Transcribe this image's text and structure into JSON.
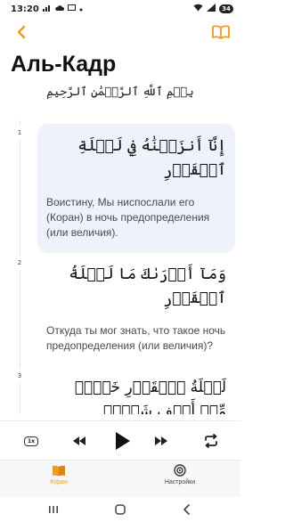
{
  "status": {
    "time": "13:20",
    "battery": "34"
  },
  "page": {
    "title": "Аль-Кадр",
    "basmala": "بِسۡمِ ٱللَّهِ ٱلرَّحۡمَٰنِ ٱلرَّحِيمِ"
  },
  "verses": [
    {
      "number": "1",
      "arabic": "إِنَّآ أَنزَلۡنَٰهُ فِي لَيۡلَةِ ٱلۡقَدۡرِ",
      "translation": "Воистину, Мы ниспослали его (Коран) в ночь предопределения (или величия)."
    },
    {
      "number": "2",
      "arabic": "وَمَآ أَدۡرَىٰكَ مَا لَيۡلَةُ ٱلۡقَدۡرِ",
      "translation": "Откуда ты мог знать, что такое ночь предопределения (или величия)?"
    },
    {
      "number": "3",
      "arabic": "لَيۡلَةُ ٱلۡقَدۡرِ خَيۡرٞ مِّنۡ أَلۡفِ شَهۡرٖ",
      "translation": ""
    }
  ],
  "player": {
    "speed_label": "1x"
  },
  "tabs": {
    "quran_label": "Коран",
    "settings_label": "Настройки"
  },
  "colors": {
    "accent": "#f09a17",
    "active_card": "#eef3fb"
  },
  "icons": [
    "back-chevron-icon",
    "book-icon",
    "skip-back-icon",
    "play-icon",
    "skip-forward-icon",
    "repeat-icon",
    "quran-book-icon",
    "settings-icon"
  ]
}
